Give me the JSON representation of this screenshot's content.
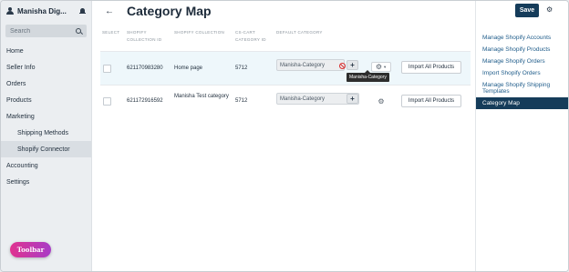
{
  "sidebar": {
    "user_name": "Manisha Dig...",
    "search_placeholder": "Search",
    "items": [
      {
        "label": "Home"
      },
      {
        "label": "Seller Info"
      },
      {
        "label": "Orders"
      },
      {
        "label": "Products"
      },
      {
        "label": "Marketing"
      },
      {
        "label": "Shipping Methods"
      },
      {
        "label": "Shopify Connector"
      },
      {
        "label": "Accounting"
      },
      {
        "label": "Settings"
      }
    ],
    "toolbar_label": "Toolbar"
  },
  "header": {
    "back_icon": "arrow-left",
    "title": "Category Map"
  },
  "table": {
    "headers": {
      "select": "SELECT",
      "shopify_collection_id": "SHOPIFY COLLECTION ID",
      "shopify_collection": "SHOPIFY COLLECTION",
      "cscart_category_id": "CS-CART CATEGORY ID",
      "default_category": "DEFAULT CATEGORY"
    },
    "rows": [
      {
        "collection_id": "621170983280",
        "collection": "Home page",
        "cscart_category_id": "5712",
        "default_category": "Manisha-Category",
        "import_label": "Import All Products"
      },
      {
        "collection_id": "621172916592",
        "collection": "Manisha Test category",
        "cscart_category_id": "5712",
        "default_category": "Manisha-Category",
        "import_label": "Import All Products"
      }
    ],
    "tooltip": "Manisha-Category"
  },
  "right_panel": {
    "save_label": "Save",
    "links": [
      {
        "label": "Manage Shopify Accounts"
      },
      {
        "label": "Manage Shopify Products"
      },
      {
        "label": "Manage Shopify Orders"
      },
      {
        "label": "Import Shopify Orders"
      },
      {
        "label": "Manage Shopify Shipping Templates"
      },
      {
        "label": "Category Map"
      }
    ]
  },
  "colors": {
    "primary": "#153c5a",
    "link": "#1f5c8a",
    "danger": "#d92d2d",
    "toolbar_gradient_start": "#e0338f",
    "toolbar_gradient_end": "#a83cc7"
  }
}
